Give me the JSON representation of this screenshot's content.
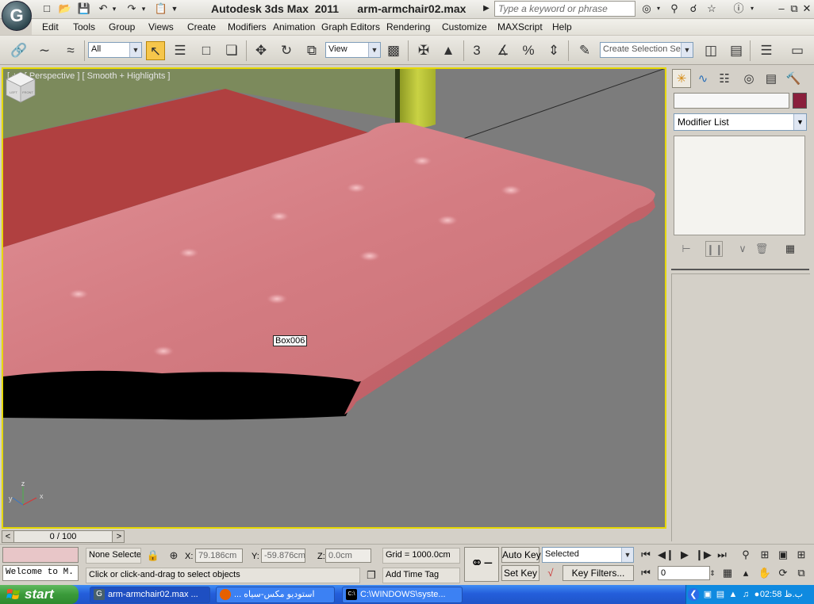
{
  "titlebar": {
    "app_name": "Autodesk 3ds Max  2011",
    "file_name": "arm-armchair02.max",
    "search_placeholder": "Type a keyword or phrase"
  },
  "menu": [
    "Edit",
    "Tools",
    "Group",
    "Views",
    "Create",
    "Modifiers",
    "Animation",
    "Graph Editors",
    "Rendering",
    "Customize",
    "MAXScript",
    "Help"
  ],
  "toolbar": {
    "selection_filter": "All",
    "reference_coord": "View",
    "angle_snap_value": "3",
    "named_selection_placeholder": "Create Selection Se"
  },
  "viewport": {
    "label": "[ + ] [ Perspective ] [ Smooth + Highlights ]",
    "object_tooltip": "Box006",
    "viewcube_faces": [
      "LEFT",
      "FRONT"
    ],
    "axis_labels": {
      "x": "x",
      "y": "y",
      "z": "z"
    },
    "colors": {
      "background": "#7c7c7c",
      "active_border": "#e6d800",
      "cushion": "#c76d72",
      "seat_red": "#b04040"
    }
  },
  "command_panel": {
    "modifier_list_label": "Modifier List",
    "object_color": "#8a1f3c"
  },
  "time_slider": {
    "label": "0 / 100",
    "prev": "<",
    "next": ">"
  },
  "statusbar": {
    "maxscript_listener": "Welcome to M.",
    "selection_status": "None Selectec",
    "x_label": "X:",
    "x_value": "79.186cm",
    "y_label": "Y:",
    "y_value": "-59.876cm",
    "z_label": "Z:",
    "z_value": "0.0cm",
    "grid": "Grid = 1000.0cm",
    "prompt": "Click or click-and-drag to select objects",
    "add_time_tag": "Add Time Tag",
    "auto_key": "Auto Key",
    "set_key": "Set Key",
    "key_mode": "Selected",
    "key_filters": "Key Filters...",
    "current_frame": "0"
  },
  "taskbar": {
    "start_label": "start",
    "tasks": [
      {
        "label": "arm-armchair02.max ...",
        "icon": "3dsmax-icon"
      },
      {
        "label": "... استوديو مكس-سياه",
        "icon": "firefox-icon"
      },
      {
        "label": "C:\\WINDOWS\\syste...",
        "icon": "cmd-icon"
      }
    ],
    "clock": "02:58 ب.ظ"
  }
}
